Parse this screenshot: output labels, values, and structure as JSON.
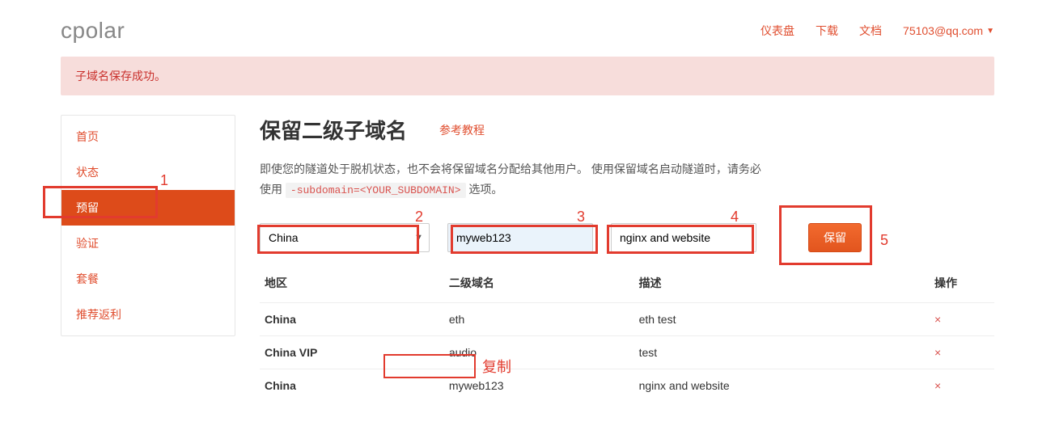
{
  "brand": "cpolar",
  "topnav": {
    "dashboard": "仪表盘",
    "download": "下载",
    "docs": "文档",
    "user_email": "75103@qq.com"
  },
  "alert": "子域名保存成功。",
  "sidebar": {
    "items": [
      {
        "label": "首页"
      },
      {
        "label": "状态"
      },
      {
        "label": "预留"
      },
      {
        "label": "验证"
      },
      {
        "label": "套餐"
      },
      {
        "label": "推荐返利"
      }
    ]
  },
  "main": {
    "title": "保留二级子域名",
    "ref_link": "参考教程",
    "desc_prefix": "即使您的隧道处于脱机状态，也不会将保留域名分配给其他用户。 使用保留域名启动隧道时，请务必使用 ",
    "desc_code": "-subdomain=<YOUR_SUBDOMAIN>",
    "desc_suffix": " 选项。",
    "form": {
      "region_selected": "China",
      "subdomain_value": "myweb123",
      "desc_value": "nginx and website",
      "submit_label": "保留"
    },
    "table": {
      "headers": {
        "region": "地区",
        "subdomain": "二级域名",
        "desc": "描述",
        "action": "操作"
      },
      "rows": [
        {
          "region": "China",
          "subdomain": "eth",
          "desc": "eth test"
        },
        {
          "region": "China VIP",
          "subdomain": "audio",
          "desc": "test"
        },
        {
          "region": "China",
          "subdomain": "myweb123",
          "desc": "nginx and website"
        }
      ]
    }
  },
  "annotations": {
    "n1": "1",
    "n2": "2",
    "n3": "3",
    "n4": "4",
    "n5": "5",
    "copy": "复制"
  }
}
